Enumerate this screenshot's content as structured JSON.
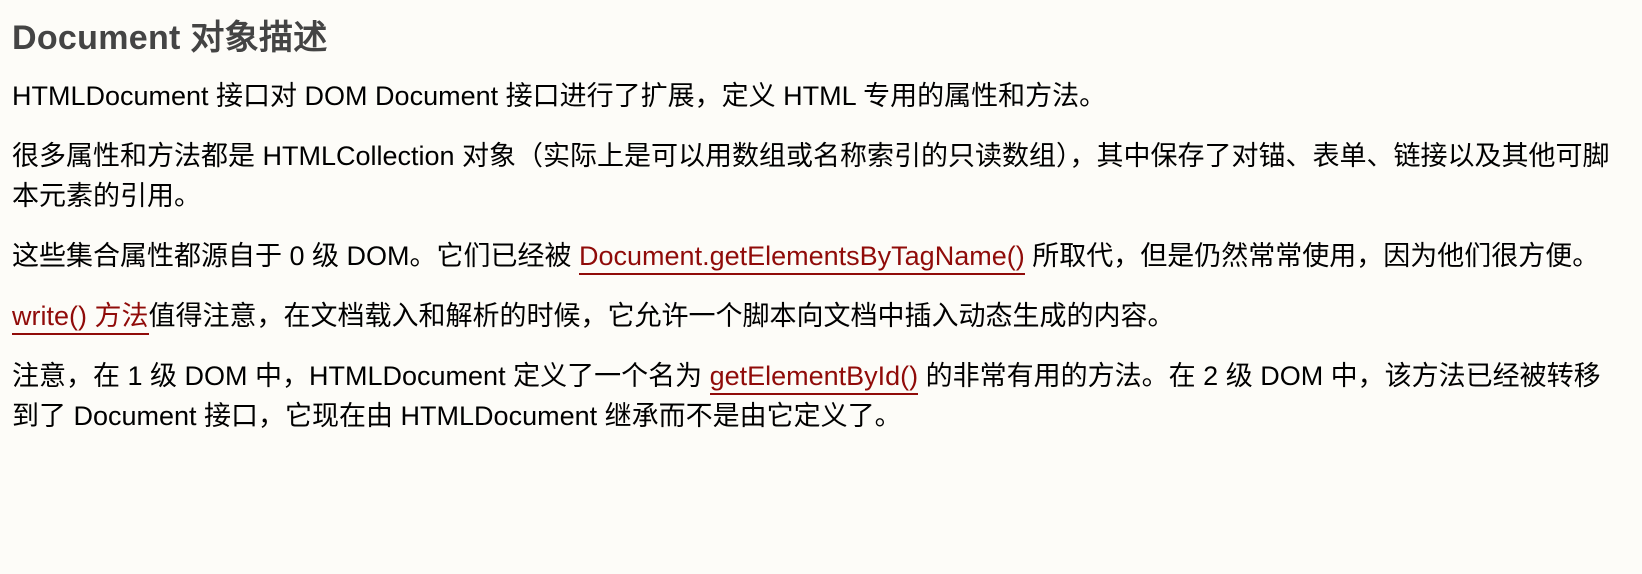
{
  "heading": "Document 对象描述",
  "p1": "HTMLDocument 接口对 DOM Document 接口进行了扩展，定义 HTML 专用的属性和方法。",
  "p2": "很多属性和方法都是 HTMLCollection 对象（实际上是可以用数组或名称索引的只读数组），其中保存了对锚、表单、链接以及其他可脚本元素的引用。",
  "p3": {
    "before": "这些集合属性都源自于 0 级 DOM。它们已经被 ",
    "link": "Document.getElementsByTagName()",
    "after": " 所取代，但是仍然常常使用，因为他们很方便。"
  },
  "p4": {
    "link": "write() 方法",
    "after": "值得注意，在文档载入和解析的时候，它允许一个脚本向文档中插入动态生成的内容。"
  },
  "p5": {
    "before": "注意，在 1 级 DOM 中，HTMLDocument 定义了一个名为 ",
    "link": "getElementById()",
    "after": " 的非常有用的方法。在 2 级 DOM 中，该方法已经被转移到了 Document 接口，它现在由 HTMLDocument 继承而不是由它定义了。"
  },
  "colors": {
    "background": "#fdfcf8",
    "heading": "#444444",
    "text": "#000000",
    "link": "#900b09"
  }
}
